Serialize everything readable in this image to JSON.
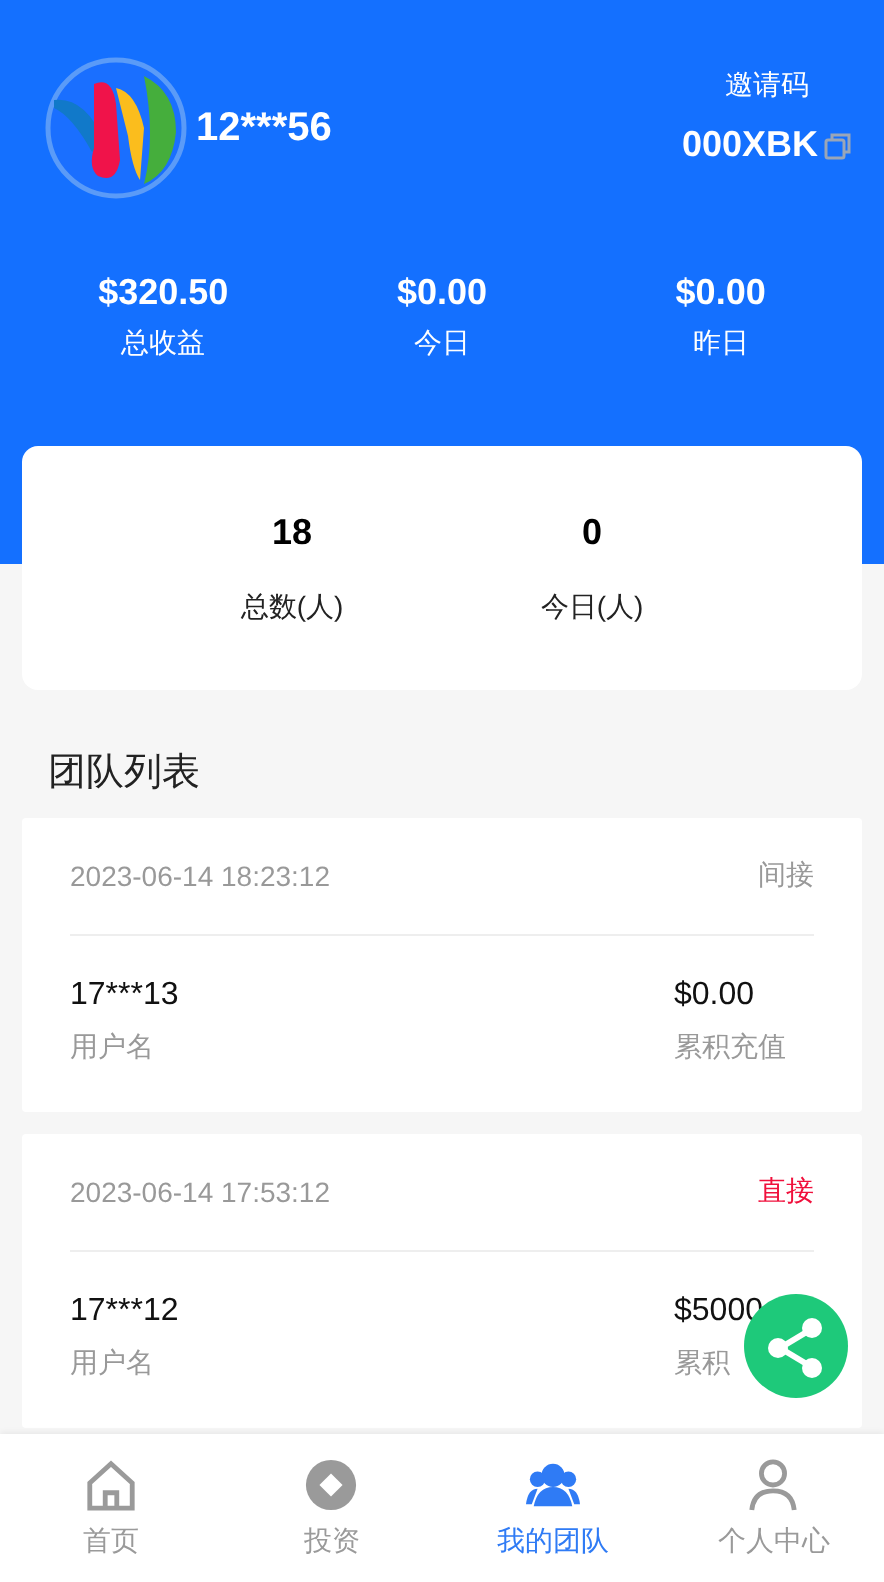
{
  "profile": {
    "username": "12***56",
    "invite_label": "邀请码",
    "invite_code": "000XBK"
  },
  "earnings": [
    {
      "value": "$320.50",
      "label": "总收益"
    },
    {
      "value": "$0.00",
      "label": "今日"
    },
    {
      "value": "$0.00",
      "label": "昨日"
    }
  ],
  "team_counts": [
    {
      "value": "18",
      "label": "总数(人)"
    },
    {
      "value": "0",
      "label": "今日(人)"
    }
  ],
  "section_title": "团队列表",
  "members": [
    {
      "time": "2023-06-14 18:23:12",
      "relation": "间接",
      "kind": "indirect",
      "username": "17***13",
      "username_label": "用户名",
      "amount": "$0.00",
      "amount_label": "累积充值"
    },
    {
      "time": "2023-06-14 17:53:12",
      "relation": "直接",
      "kind": "direct",
      "username": "17***12",
      "username_label": "用户名",
      "amount": "$5000",
      "amount_label": "累积"
    }
  ],
  "tabs": [
    {
      "label": "首页",
      "selected": false
    },
    {
      "label": "投资",
      "selected": false
    },
    {
      "label": "我的团队",
      "selected": true
    },
    {
      "label": "个人中心",
      "selected": false
    }
  ]
}
